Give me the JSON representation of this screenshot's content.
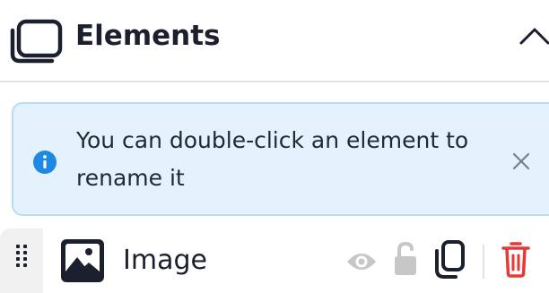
{
  "header": {
    "title": "Elements",
    "icon": "layers-icon",
    "collapse_icon": "chevron-up-icon"
  },
  "info_banner": {
    "message": "You can double-click an element to rename it",
    "icon": "info-icon",
    "close_icon": "close-icon",
    "background": "#e3f2fd",
    "border_color": "#b9dcf3",
    "icon_color": "#1e88e5"
  },
  "elements": [
    {
      "name": "Image",
      "type_icon": "image-icon",
      "actions": [
        "eye-icon",
        "lock-open-icon",
        "copy-icon",
        "trash-icon"
      ]
    }
  ],
  "colors": {
    "text": "#1b1f2e",
    "muted_icon": "#c7c7c7",
    "danger": "#e53935"
  }
}
